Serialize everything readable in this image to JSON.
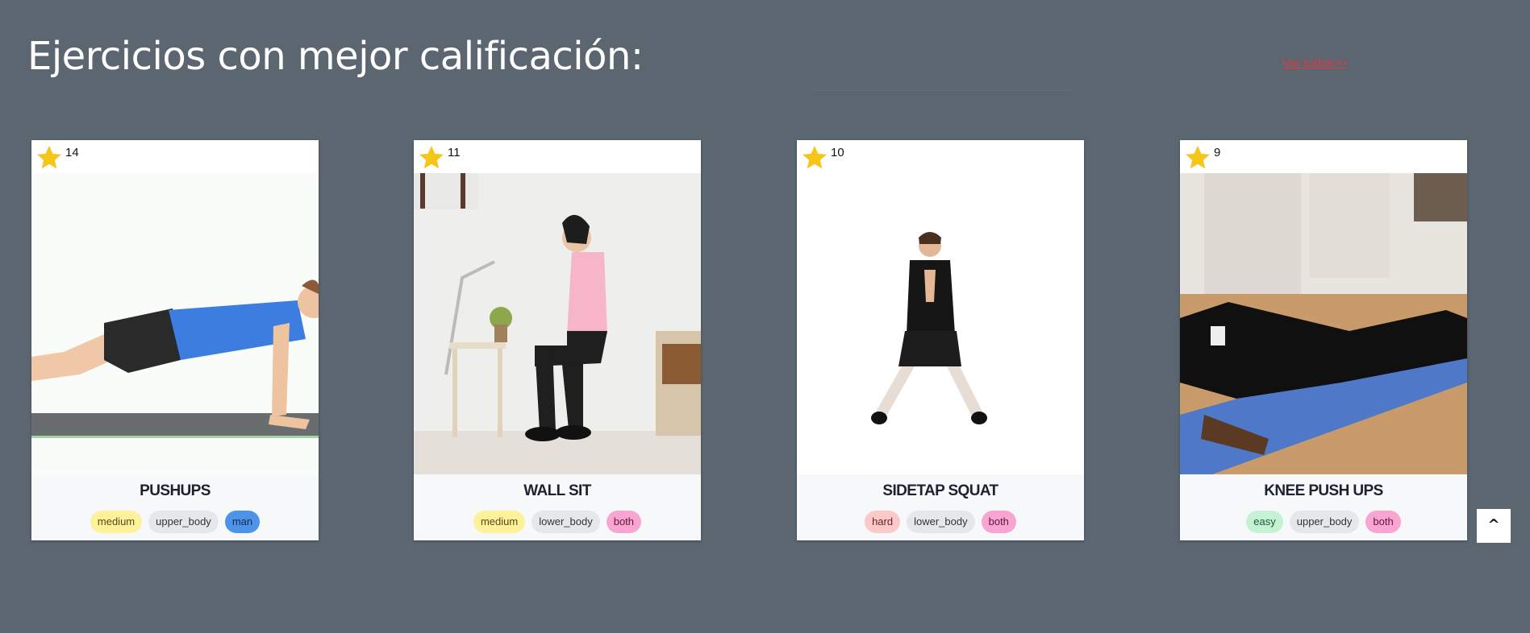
{
  "header": {
    "title": "Ejercicios con mejor calificación:",
    "see_all_label": "Ver todos>>"
  },
  "colors": {
    "background": "#5b6670",
    "star": "#f5c518",
    "link": "#e0383e"
  },
  "cards": [
    {
      "rating": "14",
      "name": "PUSHUPS",
      "tags": [
        "medium",
        "upper_body",
        "man"
      ]
    },
    {
      "rating": "11",
      "name": "WALL SIT",
      "tags": [
        "medium",
        "lower_body",
        "both"
      ]
    },
    {
      "rating": "10",
      "name": "SIDETAP SQUAT",
      "tags": [
        "hard",
        "lower_body",
        "both"
      ]
    },
    {
      "rating": "9",
      "name": "KNEE PUSH UPS",
      "tags": [
        "easy",
        "upper_body",
        "both"
      ]
    }
  ],
  "scroll_top": {
    "label": "^",
    "icon": "caret-up-icon"
  }
}
